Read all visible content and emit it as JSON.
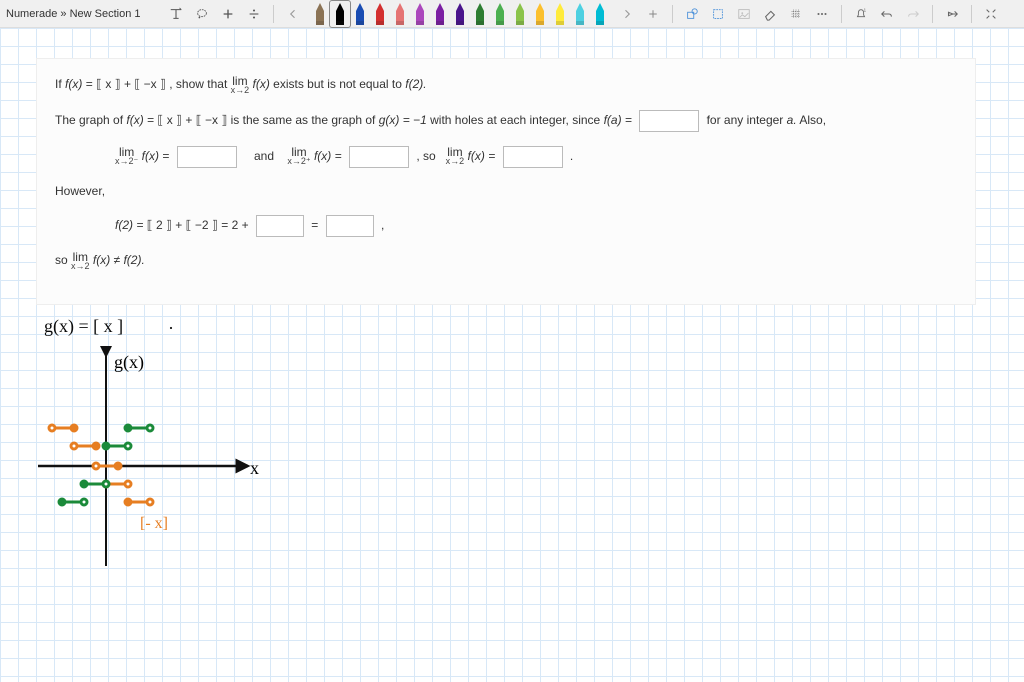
{
  "breadcrumb": {
    "site": "Numerade",
    "sep": "»",
    "section": "New Section 1"
  },
  "pens": [
    {
      "color": "#8b7355"
    },
    {
      "color": "#000000"
    },
    {
      "color": "#1a4db3"
    },
    {
      "color": "#d32f2f"
    },
    {
      "color": "#e57373"
    },
    {
      "color": "#ab47bc"
    },
    {
      "color": "#7b1fa2"
    },
    {
      "color": "#4a148c"
    },
    {
      "color": "#2e7d32"
    },
    {
      "color": "#4caf50"
    },
    {
      "color": "#8bc34a"
    },
    {
      "color": "#fbc02d"
    },
    {
      "color": "#ffeb3b"
    },
    {
      "color": "#4dd0e1"
    },
    {
      "color": "#00bcd4"
    }
  ],
  "selected_pen_index": 1,
  "problem": {
    "line1_if": "If",
    "line1_fx": "f(x)",
    "line1_eq": "=",
    "line1_br1": " x ",
    "line1_plus": "+",
    "line1_br2": " −x ",
    "line1_show": ", show that",
    "line1_lim": "lim",
    "line1_sub": "x→2",
    "line1_fx2": "f(x)",
    "line1_rest": "exists but is not equal to",
    "line1_f2": "f(2).",
    "line2_a": "The graph of",
    "line2_b": "is the same as the graph of",
    "line2_gx": "g(x) = −1",
    "line2_c": "with holes at each integer, since",
    "line2_fa": "f(a) =",
    "line2_d": "for any integer",
    "line2_e": "a.",
    "line2_f": "Also,",
    "line3_and": "and",
    "line3_so": ", so",
    "line3_sub1": "x→2⁻",
    "line3_sub2": "x→2⁺",
    "line3_sub3": "x→2",
    "line3_fx": "f(x) =",
    "line3_period": ".",
    "line4": "However,",
    "line5_a": "f(2) =",
    "line5_b1": " 2 ",
    "line5_b2": " −2 ",
    "line5_c": "= 2 +",
    "line5_eq": "=",
    "line5_comma": ",",
    "line6_a": "so",
    "line6_b": "f(x) ≠ f(2)."
  },
  "handwriting": {
    "gx": "g(x) = [ x ]",
    "dot": "·",
    "yaxis": "g(x)",
    "xaxis": "x",
    "negx": "[- x]"
  }
}
